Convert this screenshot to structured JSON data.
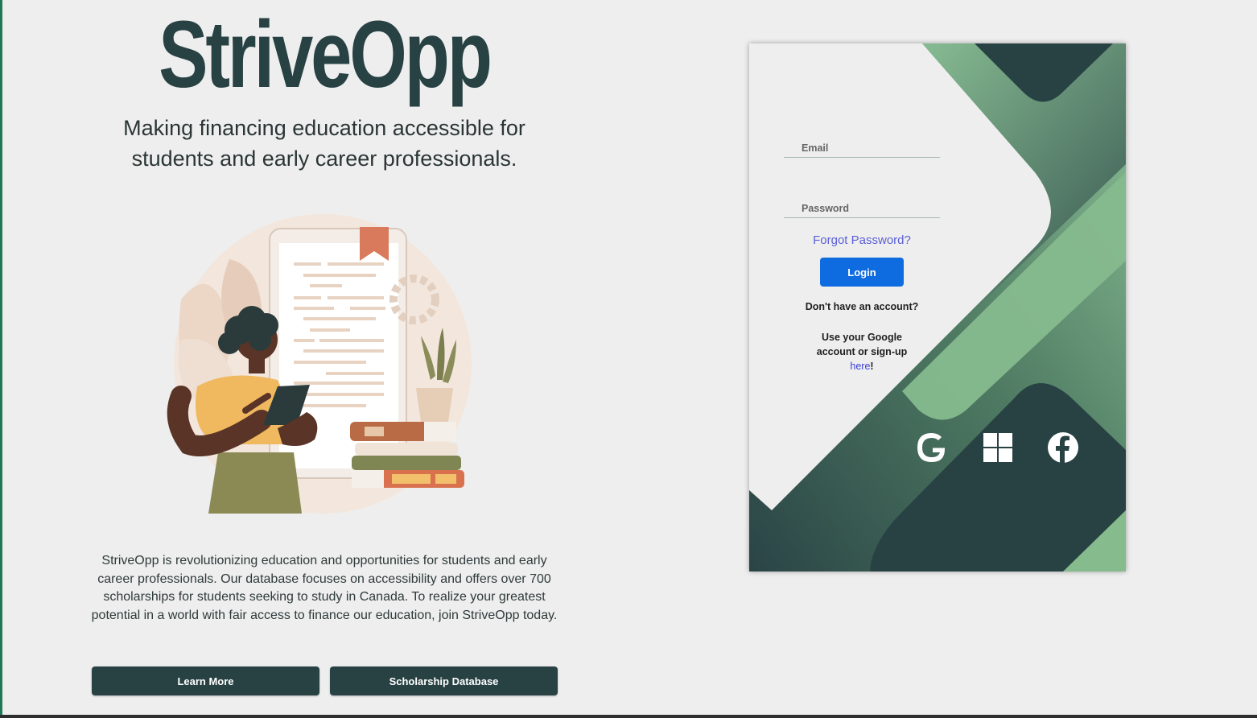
{
  "brand": {
    "name": "StriveOpp"
  },
  "hero": {
    "tagline_line1": "Making financing education accessible for",
    "tagline_line2": "students and early career professionals."
  },
  "about": {
    "description": "StriveOpp is revolutionizing education and opportunities for students and early career professionals. Our database focuses on accessibility and offers over 700 scholarships for students seeking to study in Canada. To realize your greatest potential in a world with fair access to finance our education, join StriveOpp today."
  },
  "actions": {
    "learn_more": "Learn More",
    "scholarship_database": "Scholarship Database"
  },
  "login": {
    "email_placeholder": "Email",
    "password_placeholder": "Password",
    "forgot_password": "Forgot Password?",
    "login_button": "Login",
    "no_account": "Don't have an account?",
    "google_hint": "Use your Google account or sign-up",
    "here_link": "here",
    "exclaim": "!"
  },
  "social": {
    "google_icon": "google-icon",
    "windows_icon": "windows-icon",
    "facebook_icon": "facebook-icon"
  },
  "colors": {
    "brand_dark": "#284244",
    "accent_green": "#86bb8e",
    "mid_green": "#4e7a62",
    "login_blue": "#0f6ce0",
    "link_purple": "#5b5fd6",
    "background": "#eeeeee"
  }
}
